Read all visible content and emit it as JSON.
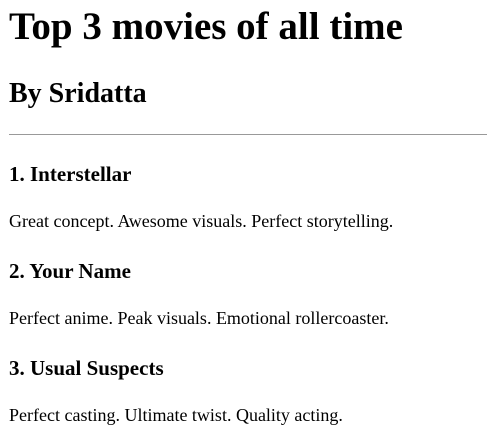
{
  "page": {
    "title": "Top 3 movies of all time",
    "byline": "By Sridatta"
  },
  "movies": [
    {
      "title": "1. Interstellar",
      "description": "Great concept. Awesome visuals. Perfect storytelling."
    },
    {
      "title": "2. Your Name",
      "description": "Perfect anime. Peak visuals. Emotional rollercoaster."
    },
    {
      "title": "3. Usual Suspects",
      "description": "Perfect casting. Ultimate twist. Quality acting."
    }
  ]
}
